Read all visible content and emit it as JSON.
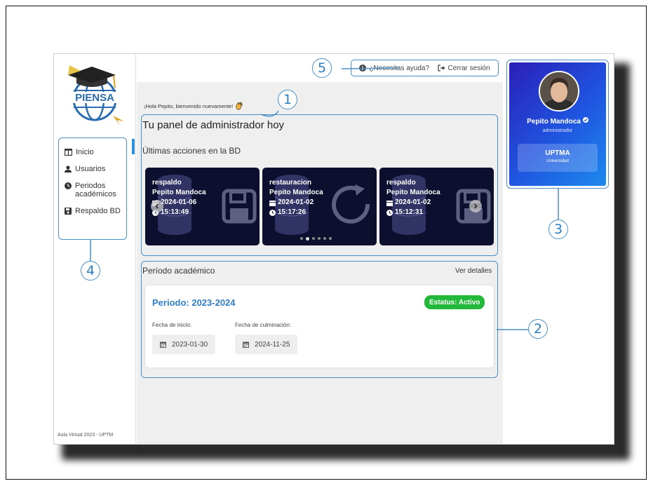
{
  "sidebar": {
    "logo_text": "PIENSA",
    "items": [
      {
        "label": "Inicio",
        "icon": "columns-icon",
        "active": true
      },
      {
        "label": "Usuarios",
        "icon": "user-icon"
      },
      {
        "label": "Periodos académicos",
        "icon": "clock-icon"
      },
      {
        "label": "Respaldo BD",
        "icon": "floppy-icon"
      }
    ],
    "footer": "Aula Virtual 2023 - UPTM"
  },
  "topbar": {
    "help_label": "¿Necesitas ayuda?",
    "logout_label": "Cerrar sesión"
  },
  "main": {
    "greeting": "¡Hola Pepito, bienvenido nuevamente!",
    "panel_title": "Tu panel de administrador hoy",
    "actions_title": "Últimas acciones en la BD",
    "cards": [
      {
        "action": "respaldo",
        "user": "Pepito Mandoca",
        "date": "2024-01-06",
        "time": "15:13:49",
        "icon": "floppy-icon"
      },
      {
        "action": "restauracion",
        "user": "Pepito Mandoca",
        "date": "2024-01-02",
        "time": "15:17:26",
        "icon": "refresh-icon"
      },
      {
        "action": "respaldo",
        "user": "Pepito Mandoca",
        "date": "2024-01-02",
        "time": "15:12:31",
        "icon": "floppy-icon"
      }
    ],
    "carousel_dots": 6,
    "carousel_active_dot": 1,
    "periodo": {
      "section_title": "Período académico",
      "details_link": "Ver detalles",
      "title": "Periodo: 2023-2024",
      "status": "Estatus: Activo",
      "start_label": "Fecha de inicio:",
      "start_date": "2023-01-30",
      "end_label": "Fecha de culminación:",
      "end_date": "2024-11-25"
    }
  },
  "profile": {
    "name": "Pepito Mandoca",
    "role": "administrador",
    "institution": "UPTMA",
    "institution_type": "Universidad"
  },
  "callouts": [
    "1",
    "2",
    "3",
    "4",
    "5"
  ],
  "colors": {
    "accent": "#2f7ec6",
    "annotation": "#4a8fc4",
    "status_green": "#22b93a",
    "card_bg": "#0d0f2e",
    "profile_gradient_start": "#2b1fb8",
    "profile_gradient_end": "#1d8aee"
  }
}
